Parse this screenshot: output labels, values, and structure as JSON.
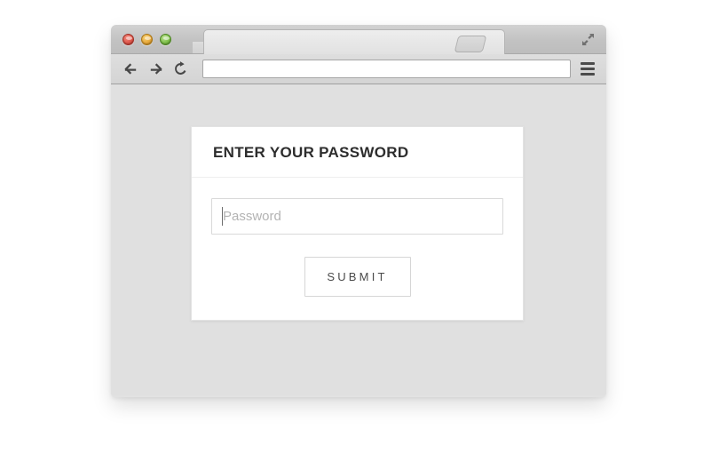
{
  "browser": {
    "window_controls": [
      {
        "name": "close",
        "color": "#e0584c"
      },
      {
        "name": "minimize",
        "color": "#e8a93a"
      },
      {
        "name": "maximize",
        "color": "#7fc04a"
      }
    ],
    "fullscreen_icon": "expand-diagonal-arrows-icon",
    "tab": {
      "title": "",
      "new_tab_label": ""
    },
    "toolbar": {
      "back_icon": "←",
      "forward_icon": "→",
      "reload_icon": "reload-icon",
      "menu_icon": "hamburger-menu-icon",
      "address_value": "",
      "address_placeholder": ""
    }
  },
  "page": {
    "background_color": "#e0e0e0",
    "card": {
      "title": "ENTER YOUR PASSWORD",
      "password_field": {
        "value": "",
        "placeholder": "Password",
        "type": "password",
        "caret_visible": true
      },
      "submit_label": "SUBMIT"
    }
  },
  "colors": {
    "chrome_titlebar": "#c4c4c4",
    "chrome_toolbar": "#d8d8d8",
    "page_bg": "#e0e0e0",
    "card_bg": "#ffffff",
    "title_text": "#2d2d2d",
    "placeholder_text": "#b3b3b3",
    "button_border": "#d6d6d6",
    "page_canvas": "#ffffff"
  }
}
